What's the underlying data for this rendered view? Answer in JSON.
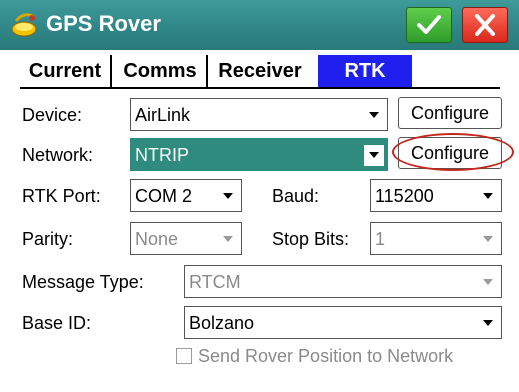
{
  "window": {
    "title": "GPS Rover",
    "app_icon": "satellite-rover-icon",
    "ok_icon": "checkmark-icon",
    "close_icon": "x-close-icon",
    "ok_color": "#3fb53a",
    "close_color": "#e43b2e"
  },
  "tabs": [
    {
      "label": "Current",
      "active": false
    },
    {
      "label": "Comms",
      "active": false
    },
    {
      "label": "Receiver",
      "active": false
    },
    {
      "label": "RTK",
      "active": true
    }
  ],
  "form": {
    "device": {
      "label": "Device:",
      "value": "AirLink",
      "button": "Configure"
    },
    "network": {
      "label": "Network:",
      "value": "NTRIP",
      "button": "Configure"
    },
    "rtk_port": {
      "label": "RTK Port:",
      "value": "COM 2"
    },
    "baud": {
      "label": "Baud:",
      "value": "115200"
    },
    "parity": {
      "label": "Parity:",
      "value": "None",
      "enabled": false
    },
    "stop_bits": {
      "label": "Stop Bits:",
      "value": "1",
      "enabled": false
    },
    "message_type": {
      "label": "Message Type:",
      "value": "RTCM",
      "enabled": false
    },
    "base_id": {
      "label": "Base ID:",
      "value": "Bolzano"
    },
    "send_rover_position": {
      "label": "Send Rover Position to Network",
      "checked": false,
      "enabled": false
    }
  },
  "colors": {
    "titlebar": "#2f8585",
    "active_tab": "#1f1ff0",
    "selection": "#2e8b7e",
    "annotation_circle": "#c4261e"
  }
}
